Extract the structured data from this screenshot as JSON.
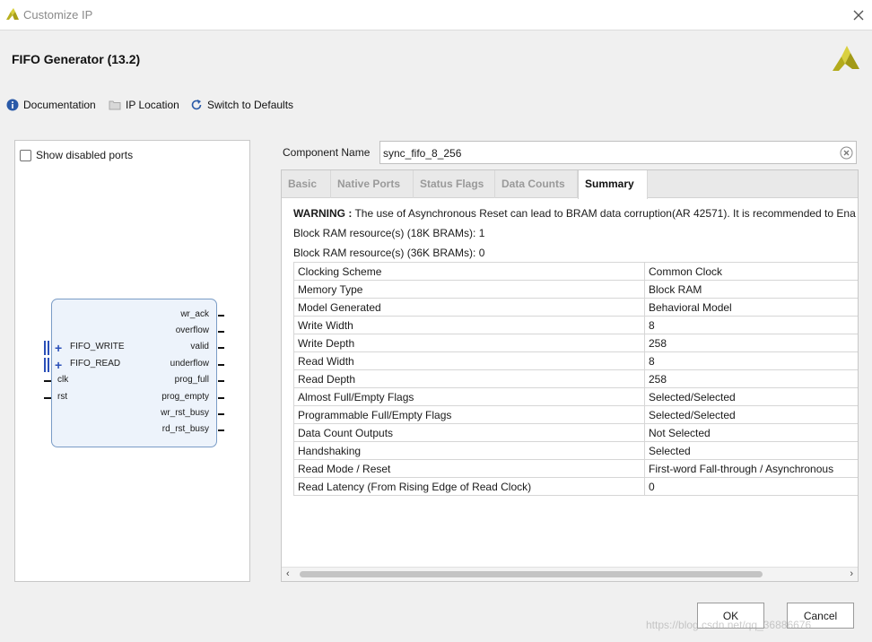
{
  "window": {
    "title": "Customize IP"
  },
  "header": {
    "title": "FIFO Generator (13.2)"
  },
  "toolbar": {
    "documentation": "Documentation",
    "ip_location": "IP Location",
    "switch_defaults": "Switch to Defaults"
  },
  "preview": {
    "show_disabled_ports": "Show disabled ports",
    "right_ports": [
      "wr_ack",
      "overflow",
      "valid",
      "underflow",
      "prog_full",
      "prog_empty",
      "wr_rst_busy",
      "rd_rst_busy"
    ],
    "left_ports": [
      "FIFO_WRITE",
      "FIFO_READ",
      "clk",
      "rst"
    ]
  },
  "component": {
    "label": "Component Name",
    "value": "sync_fifo_8_256"
  },
  "tabs": [
    "Basic",
    "Native Ports",
    "Status Flags",
    "Data Counts",
    "Summary"
  ],
  "active_tab": "Summary",
  "summary": {
    "warning_label": "WARNING :",
    "warning_text": "The use of Asynchronous Reset can lead to BRAM data corruption(AR 42571). It is recommended to Ena",
    "bram18": "Block RAM resource(s) (18K BRAMs): 1",
    "bram36": "Block RAM resource(s) (36K BRAMs): 0",
    "rows": [
      {
        "k": "Clocking Scheme",
        "v": "Common Clock"
      },
      {
        "k": "Memory Type",
        "v": "Block RAM"
      },
      {
        "k": "Model Generated",
        "v": "Behavioral Model"
      },
      {
        "k": "Write Width",
        "v": "8"
      },
      {
        "k": "Write Depth",
        "v": "258"
      },
      {
        "k": "Read Width",
        "v": "8"
      },
      {
        "k": "Read Depth",
        "v": "258"
      },
      {
        "k": "Almost Full/Empty Flags",
        "v": "Selected/Selected"
      },
      {
        "k": "Programmable Full/Empty Flags",
        "v": "Selected/Selected"
      },
      {
        "k": "Data Count Outputs",
        "v": "Not Selected"
      },
      {
        "k": "Handshaking",
        "v": "Selected"
      },
      {
        "k": "Read Mode / Reset",
        "v": "First-word Fall-through / Asynchronous"
      },
      {
        "k": "Read Latency (From Rising Edge of Read Clock)",
        "v": "0"
      }
    ]
  },
  "buttons": {
    "ok": "OK",
    "cancel": "Cancel"
  },
  "watermark": "https://blog.csdn.net/qq_36886676",
  "icons": {
    "info": "info-icon",
    "folder": "folder-icon",
    "refresh": "refresh-icon",
    "close": "close-icon",
    "clear": "clear-icon",
    "brand": "xilinx-logo-icon"
  },
  "colors": {
    "brand_yellow": "#c8c02a",
    "info_blue": "#2a5aa8",
    "block_fill": "#edf3fb",
    "block_border": "#7a9cc6",
    "bus_blue": "#2a4fb8"
  }
}
